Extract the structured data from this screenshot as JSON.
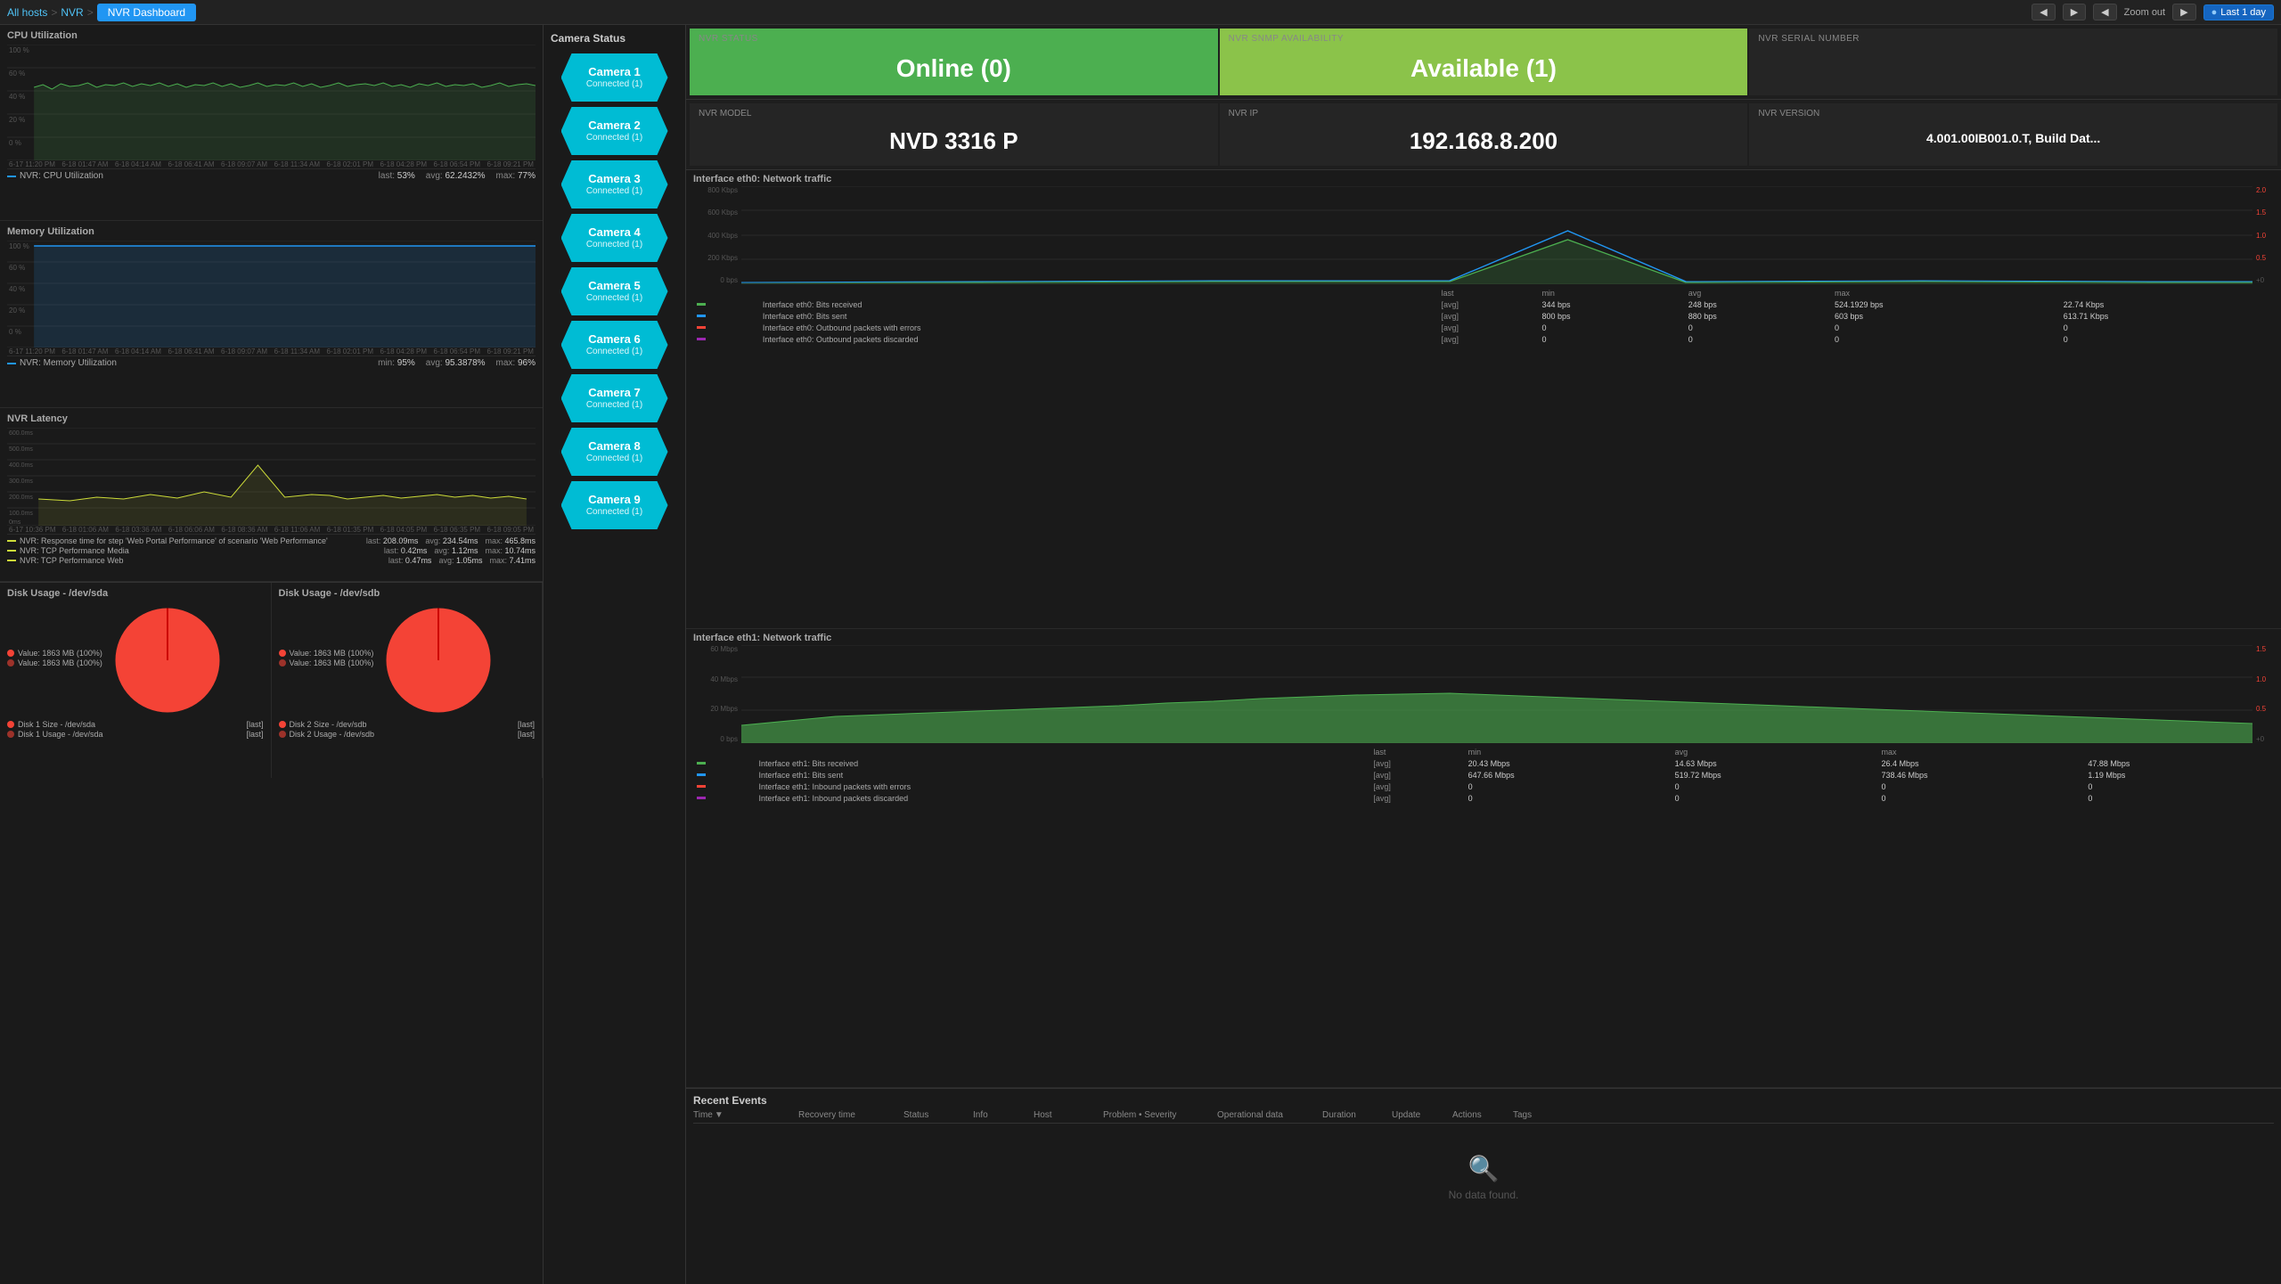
{
  "nav": {
    "all_hosts": "All hosts",
    "separator1": ">",
    "nvr": "NVR",
    "separator2": ">",
    "active_tab": "NVR Dashboard",
    "zoom_label": "Zoom out",
    "last_day": "Last 1 day"
  },
  "cpu_panel": {
    "title": "CPU Utilization",
    "y_labels": [
      "100%",
      "60%",
      "40%",
      "20%",
      "0%"
    ],
    "x_labels": [
      "6-17 11:20 PM",
      "6-18 01:47 AM",
      "6-18 04:14 AM",
      "6-18 06:41 AM",
      "6-18 09:07 AM",
      "6-18 11:34 AM",
      "6-18 02:01 PM",
      "6-18 04:28 PM",
      "6-18 06:54 PM",
      "6-18 09:21 PM"
    ],
    "legend": "NVR: CPU Utilization",
    "stat_last": "53%",
    "stat_avg": "62.2432%",
    "stat_max": "77%"
  },
  "mem_panel": {
    "title": "Memory Utilization",
    "y_labels": [
      "100%",
      "60%",
      "40%",
      "20%",
      "0%"
    ],
    "x_labels": [
      "6-17 11:20 PM",
      "6-18 01:47 AM",
      "6-18 04:14 AM",
      "6-18 06:41 AM",
      "6-18 09:07 AM",
      "6-18 11:34 AM",
      "6-18 02:01 PM",
      "6-18 04:28 PM",
      "6-18 06:54 PM",
      "6-18 09:21 PM"
    ],
    "legend": "NVR: Memory Utilization",
    "stat_min": "95%",
    "stat_avg": "95.3878%",
    "stat_max": "96%"
  },
  "latency_panel": {
    "title": "NVR Latency",
    "y_labels": [
      "600.0ms",
      "500.0ms",
      "400.0ms",
      "300.0ms",
      "200.0ms",
      "100.0ms",
      "0ms"
    ],
    "x_labels": [
      "6-17 10:36 PM",
      "6-18 01:06 AM",
      "6-18 03:36 AM",
      "6-18 06:06 AM",
      "6-18 08:36 AM",
      "6-18 11:06 AM",
      "6-18 01:35 PM",
      "6-18 04:05 PM",
      "6-18 06:35 PM",
      "6-18 09:05 PM"
    ],
    "legend1": "NVR: Response time for step 'Web Portal Performance' of scenario 'Web Performance'",
    "legend1_last": "208.09ms",
    "legend1_avg": "234.54ms",
    "legend1_max": "465.8ms",
    "legend2": "NVR: TCP Performance Media",
    "legend2_last": "0.42ms",
    "legend2_avg": "1.12ms",
    "legend2_max": "10.74ms",
    "legend3": "NVR: TCP Performance Web",
    "legend3_last": "0.47ms",
    "legend3_avg": "1.05ms",
    "legend3_max": "7.41ms"
  },
  "disk_sda": {
    "title": "Disk Usage - /dev/sda",
    "legend1_label": "Value: 1863 MB (100%)",
    "legend2_label": "Value: 1863 MB (100%)"
  },
  "disk_sdb": {
    "title": "Disk Usage - /dev/sdb",
    "legend1_label": "Value: 1863 MB (100%)",
    "legend2_label": "Value: 1863 MB (100%)"
  },
  "disk_sda_footer": {
    "line1_label": "Disk 1 Size - /dev/sda",
    "line1_tag": "[last]",
    "line2_label": "Disk 1 Usage - /dev/sda",
    "line2_tag": "[last]"
  },
  "disk_sdb_footer": {
    "line1_label": "Disk 2 Size - /dev/sdb",
    "line1_tag": "[last]",
    "line2_label": "Disk 2 Usage - /dev/sdb",
    "line2_tag": "[last]"
  },
  "camera_status": {
    "title": "Camera Status",
    "cameras": [
      {
        "name": "Camera 1",
        "status": "Connected (1)"
      },
      {
        "name": "Camera 2",
        "status": "Connected (1)"
      },
      {
        "name": "Camera 3",
        "status": "Connected (1)"
      },
      {
        "name": "Camera 4",
        "status": "Connected (1)"
      },
      {
        "name": "Camera 5",
        "status": "Connected (1)"
      },
      {
        "name": "Camera 6",
        "status": "Connected (1)"
      },
      {
        "name": "Camera 7",
        "status": "Connected (1)"
      },
      {
        "name": "Camera 8",
        "status": "Connected (1)"
      },
      {
        "name": "Camera 9",
        "status": "Connected (1)"
      }
    ]
  },
  "nvr_status": {
    "title": "NVR STATUS",
    "value": "Online (0)",
    "snmp_title": "NVR SNMP AVAILABILITY",
    "snmp_value": "Available (1)",
    "serial_title": "NVR SERIAL NUMBER",
    "serial_value": ""
  },
  "nvr_info": {
    "model_title": "NVR MODEL",
    "model_value": "NVD 3316 P",
    "ip_title": "NVR IP",
    "ip_value": "192.168.8.200",
    "version_title": "NVR VERSION",
    "version_value": "4.001.00IB001.0.T, Build Dat..."
  },
  "net_eth0": {
    "title": "Interface eth0: Network traffic",
    "y_labels_left": [
      "800 Kbps",
      "600 Kbps",
      "400 Kbps",
      "200 Kbps",
      "0 bps"
    ],
    "y_labels_right": [
      "2.0",
      "1.5",
      "1.0",
      "0.5",
      "+0"
    ],
    "stats": [
      {
        "color": "#4caf50",
        "label": "Interface eth0: Bits received",
        "tag": "[avg]",
        "last": "344 bps",
        "min": "248 bps",
        "avg": "524.1929 bps",
        "max": "22.74 Kbps"
      },
      {
        "color": "#2196f3",
        "label": "Interface eth0: Bits sent",
        "tag": "[avg]",
        "last": "800 bps",
        "min": "880 bps",
        "avg": "603 bps",
        "max": "613.71 Kbps"
      },
      {
        "color": "#f44336",
        "label": "Interface eth0: Outbound packets with errors",
        "tag": "[avg]",
        "last": "0",
        "min": "0",
        "avg": "0",
        "max": "0"
      },
      {
        "color": "#9c27b0",
        "label": "Interface eth0: Outbound packets discarded",
        "tag": "[avg]",
        "last": "0",
        "min": "0",
        "avg": "0",
        "max": "0"
      }
    ]
  },
  "net_eth1": {
    "title": "Interface eth1: Network traffic",
    "y_labels_left": [
      "60 Mbps",
      "40 Mbps",
      "20 Mbps",
      "0 bps"
    ],
    "y_labels_right": [
      "1.5",
      "1.0",
      "0.5",
      "+0"
    ],
    "stats": [
      {
        "color": "#4caf50",
        "label": "Interface eth1: Bits received",
        "tag": "[avg]",
        "last": "20.43 Mbps",
        "min": "14.63 Mbps",
        "avg": "26.4 Mbps",
        "max": "47.88 Mbps"
      },
      {
        "color": "#2196f3",
        "label": "Interface eth1: Bits sent",
        "tag": "[avg]",
        "last": "647.66 Mbps",
        "min": "519.72 Mbps",
        "avg": "738.46 Mbps",
        "max": "1.19 Mbps"
      },
      {
        "color": "#f44336",
        "label": "Interface eth1: Inbound packets with errors",
        "tag": "[avg]",
        "last": "0",
        "min": "0",
        "avg": "0",
        "max": "0"
      },
      {
        "color": "#9c27b0",
        "label": "Interface eth1: Inbound packets discarded",
        "tag": "[avg]",
        "last": "0",
        "min": "0",
        "avg": "0",
        "max": "0"
      }
    ]
  },
  "recent_events": {
    "title": "Recent Events",
    "columns": [
      "Time",
      "Recovery time",
      "Status",
      "Info",
      "Host",
      "Problem • Severity",
      "Operational data",
      "Duration",
      "Update",
      "Actions",
      "Tags"
    ],
    "no_data": "No data found."
  }
}
